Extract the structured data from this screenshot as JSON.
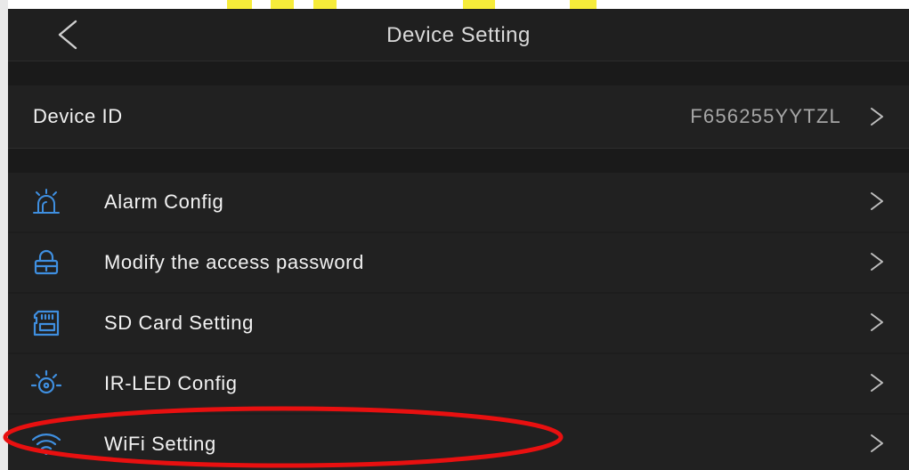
{
  "header": {
    "title": "Device Setting",
    "back_icon": "chevron-left-icon"
  },
  "device": {
    "label": "Device ID",
    "value": "F656255YYTZL",
    "chevron": ">"
  },
  "items": [
    {
      "label": "Alarm Config",
      "icon": "alarm-siren-icon",
      "chevron": ">"
    },
    {
      "label": "Modify the access password",
      "icon": "lock-icon",
      "chevron": ">"
    },
    {
      "label": "SD Card Setting",
      "icon": "sd-card-icon",
      "chevron": ">"
    },
    {
      "label": "IR-LED Config",
      "icon": "ir-led-icon",
      "chevron": ">"
    },
    {
      "label": "WiFi Setting",
      "icon": "wifi-icon",
      "chevron": ">"
    }
  ],
  "colors": {
    "background": "#1d1d1d",
    "row": "#212121",
    "text": "#f2f2f2",
    "value_text": "#a6a6a6",
    "icon_accent": "#3f8fe0",
    "highlight": "#e81010"
  }
}
